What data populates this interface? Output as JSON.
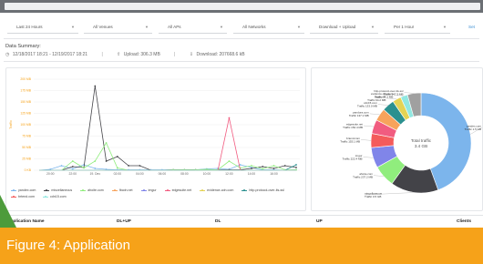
{
  "filters": {
    "time": "Last 24 Hours",
    "venues": "All Venues",
    "aps": "All APs",
    "networks": "All Networks",
    "direction": "Download + Upload",
    "interval": "Per 1 Hour",
    "action": "Set"
  },
  "summary": {
    "title": "Data Summary:",
    "range": "12/18/2017 18:21 - 12/19/2017 18:21",
    "upload": "Upload: 306.3 MB",
    "download": "Download: 207668.6 kB",
    "separator": "|"
  },
  "chart_data": [
    {
      "type": "line",
      "ylabel": "Traffic",
      "ylim": [
        0,
        200
      ],
      "y_ticks": [
        "200 MB",
        "175 MB",
        "150 MB",
        "125 MB",
        "100 MB",
        "75 MB",
        "50 MB",
        "25 MB",
        "0 KB"
      ],
      "x_ticks": [
        "20:00",
        "22:00",
        "19. Dec",
        "02:00",
        "04:00",
        "06:00",
        "08:00",
        "10:00",
        "12:00",
        "14:00",
        "16:00"
      ],
      "x": [
        "19:00",
        "20:00",
        "21:00",
        "22:00",
        "23:00",
        "00:00",
        "01:00",
        "02:00",
        "03:00",
        "04:00",
        "05:00",
        "06:00",
        "07:00",
        "08:00",
        "09:00",
        "10:00",
        "11:00",
        "12:00",
        "13:00",
        "14:00",
        "15:00",
        "16:00",
        "17:00",
        "18:00"
      ],
      "series": [
        {
          "name": "yandex.com",
          "color": "#7cb5ec",
          "values": [
            0,
            2,
            10,
            3,
            12,
            4,
            2,
            1,
            1,
            1,
            1,
            1,
            1,
            1,
            1,
            3,
            4,
            2,
            12,
            6,
            1,
            1,
            0,
            1
          ]
        },
        {
          "name": "miscellaneous",
          "color": "#434348",
          "values": [
            0,
            0,
            0,
            8,
            6,
            185,
            20,
            30,
            10,
            10,
            0,
            0,
            1,
            1,
            1,
            1,
            1,
            1,
            1,
            4,
            8,
            4,
            10,
            6
          ]
        },
        {
          "name": "ahoite.com",
          "color": "#90ed7d",
          "values": [
            0,
            0,
            0,
            20,
            5,
            20,
            60,
            5,
            0,
            0,
            0,
            0,
            1,
            1,
            1,
            2,
            1,
            20,
            5,
            10,
            3,
            10,
            1,
            1
          ]
        },
        {
          "name": "fbcdn.net",
          "color": "#f7a35c",
          "values": [
            0,
            0,
            0,
            0,
            0,
            0,
            0,
            0,
            0,
            0,
            0,
            0,
            0,
            0,
            0,
            0,
            0,
            0,
            0,
            0,
            0,
            0,
            0,
            0
          ]
        },
        {
          "name": "imgur",
          "color": "#8085e9",
          "values": [
            0,
            0,
            0,
            0,
            0,
            0,
            0,
            0,
            0,
            0,
            0,
            0,
            0,
            0,
            0,
            0,
            0,
            0,
            0,
            0,
            0,
            0,
            0,
            0
          ]
        },
        {
          "name": "edgesuite.net",
          "color": "#f15c80",
          "values": [
            0,
            0,
            0,
            0,
            0,
            0,
            0,
            0,
            0,
            0,
            0,
            0,
            0,
            0,
            0,
            0,
            0,
            115,
            0,
            0,
            0,
            0,
            0,
            0
          ]
        },
        {
          "name": "evidence-cdn.com",
          "color": "#e4d354",
          "values": [
            0,
            0,
            0,
            0,
            0,
            0,
            0,
            0,
            0,
            0,
            0,
            0,
            0,
            0,
            0,
            0,
            0,
            0,
            0,
            0,
            0,
            0,
            0,
            0
          ]
        },
        {
          "name": "http-protocol-over-tls-ssl",
          "color": "#2b908f",
          "values": [
            0,
            0,
            0,
            0,
            0,
            0,
            0,
            0,
            0,
            0,
            0,
            0,
            0,
            0,
            0,
            0,
            0,
            0,
            0,
            0,
            0,
            0,
            0,
            12
          ]
        },
        {
          "name": "brtend.com",
          "color": "#f45b5b",
          "values": [
            0,
            0,
            0,
            0,
            0,
            0,
            0,
            0,
            0,
            0,
            0,
            0,
            0,
            0,
            0,
            0,
            0,
            0,
            0,
            0,
            0,
            0,
            0,
            0
          ]
        },
        {
          "name": "cdn15.com",
          "color": "#91e8e1",
          "values": [
            0,
            0,
            0,
            0,
            0,
            0,
            0,
            0,
            0,
            0,
            0,
            0,
            0,
            0,
            0,
            0,
            0,
            0,
            0,
            0,
            0,
            0,
            0,
            0
          ]
        }
      ]
    },
    {
      "type": "pie",
      "center_label": "Total traffic",
      "center_value": "3.4 GB",
      "slices": [
        {
          "label": "yandex.com",
          "sub": "Traffic 1.5 GB",
          "value": 1500,
          "color": "#7cb5ec"
        },
        {
          "label": "miscellaneous",
          "sub": "Traffic 0.5 GB",
          "value": 520,
          "color": "#434348"
        },
        {
          "label": "ahoite.com",
          "sub": "Traffic 237.2 MB",
          "value": 237.2,
          "color": "#90ed7d"
        },
        {
          "label": "imgur",
          "sub": "Traffic 222.4 MB",
          "value": 222.4,
          "color": "#8085e9"
        },
        {
          "label": "brtend.com",
          "sub": "Traffic 153.1 MB",
          "value": 153.1,
          "color": "#f45b5b"
        },
        {
          "label": "edgesuite.net",
          "sub": "Traffic 152.4 MB",
          "value": 152.4,
          "color": "#f15c80"
        },
        {
          "label": "pandora.com",
          "sub": "Traffic 137.1 MB",
          "value": 137.1,
          "color": "#f7a35c"
        },
        {
          "label": "cdn15.com",
          "sub": "Traffic 133.0 MB",
          "value": 133.0,
          "color": "#2b908f"
        },
        {
          "label": "fbcdn.net",
          "sub": "Traffic 94.2 MB",
          "value": 94.2,
          "color": "#e4d354"
        },
        {
          "label": "evidence-cdn.com",
          "sub": "Traffic 77.2 MB",
          "value": 77.2,
          "color": "#91e8e1"
        },
        {
          "label": "http-protocol-over-tls-ssl",
          "sub": "Traffic 147.3 MB",
          "value": 147.3,
          "color": "#a0a0a0"
        }
      ]
    }
  ],
  "table": {
    "columns": [
      "Application Name",
      "DL+UP",
      "DL",
      "UP",
      "Clients"
    ]
  },
  "caption": {
    "text": "Figure 4: Application"
  }
}
